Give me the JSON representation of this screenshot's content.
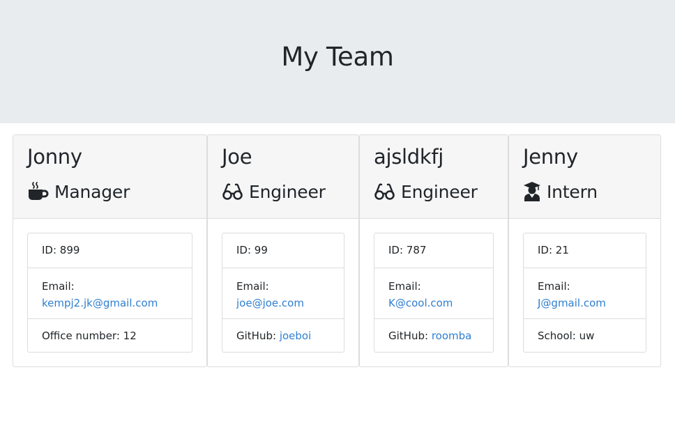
{
  "header": {
    "title": "My Team"
  },
  "colors": {
    "jumbotron_bg": "#e9ecef",
    "link": "#2f7fd1",
    "text": "#212529"
  },
  "cards": [
    {
      "name": "Jonny",
      "role": "Manager",
      "icon": "coffee-cup-icon",
      "id_text": "ID: 899",
      "email_label": "Email:",
      "email": "kempj2.jk@gmail.com",
      "extra_label": "Office number: 12",
      "extra_link": ""
    },
    {
      "name": "Joe",
      "role": "Engineer",
      "icon": "glasses-icon",
      "id_text": "ID: 99",
      "email_label": "Email:",
      "email": "joe@joe.com",
      "extra_label": "GitHub: ",
      "extra_link": "joeboi"
    },
    {
      "name": "ajsldkfj",
      "role": "Engineer",
      "icon": "glasses-icon",
      "id_text": "ID: 787",
      "email_label": "Email:",
      "email": "K@cool.com",
      "extra_label": "GitHub: ",
      "extra_link": "roomba"
    },
    {
      "name": "Jenny",
      "role": "Intern",
      "icon": "graduate-icon",
      "id_text": "ID: 21",
      "email_label": "Email:",
      "email": "J@gmail.com",
      "extra_label": "School: uw",
      "extra_link": ""
    }
  ]
}
